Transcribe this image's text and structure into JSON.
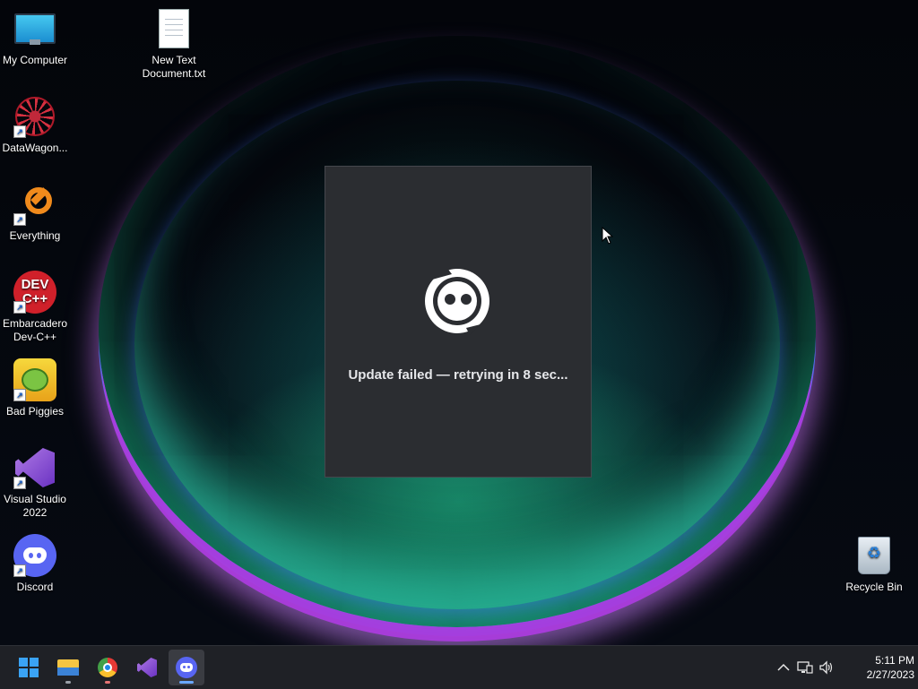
{
  "desktop": {
    "icons": [
      {
        "label": "My Computer",
        "icon": "computer-icon"
      },
      {
        "label": "New Text Document.txt",
        "icon": "text-file-icon"
      },
      {
        "label": "DataWagon...",
        "icon": "datawagon-icon",
        "shortcut": true
      },
      {
        "label": "Everything",
        "icon": "everything-search-icon",
        "shortcut": true
      },
      {
        "label": "Embarcadero Dev-C++",
        "icon": "devcpp-icon",
        "icon_text": "DEV C++",
        "shortcut": true
      },
      {
        "label": "Bad Piggies",
        "icon": "bad-piggies-icon",
        "shortcut": true
      },
      {
        "label": "Visual Studio 2022",
        "icon": "visual-studio-icon",
        "shortcut": true
      },
      {
        "label": "Discord",
        "icon": "discord-icon",
        "shortcut": true
      },
      {
        "label": "Recycle Bin",
        "icon": "recycle-bin-icon"
      }
    ]
  },
  "dialog": {
    "app": "Discord",
    "logo": "discord-updater-logo",
    "message": "Update failed — retrying in 8 sec..."
  },
  "taskbar": {
    "items": [
      {
        "name": "start",
        "icon": "windows-start-icon"
      },
      {
        "name": "file-explorer",
        "icon": "folder-icon",
        "running": true
      },
      {
        "name": "chrome",
        "icon": "chrome-icon",
        "running": true
      },
      {
        "name": "visual-studio",
        "icon": "visual-studio-icon",
        "running": false
      },
      {
        "name": "discord",
        "icon": "discord-icon",
        "running": true,
        "active": true
      }
    ],
    "tray": {
      "icons": [
        "chevron-up-icon",
        "network-icon",
        "volume-icon"
      ],
      "time": "5:11 PM",
      "date": "2/27/2023"
    }
  },
  "colors": {
    "dialog_bg": "#2b2d31",
    "taskbar_bg": "#1f2126",
    "discord_blurple": "#5865f2",
    "bloom_accent": "#a63cdc"
  }
}
